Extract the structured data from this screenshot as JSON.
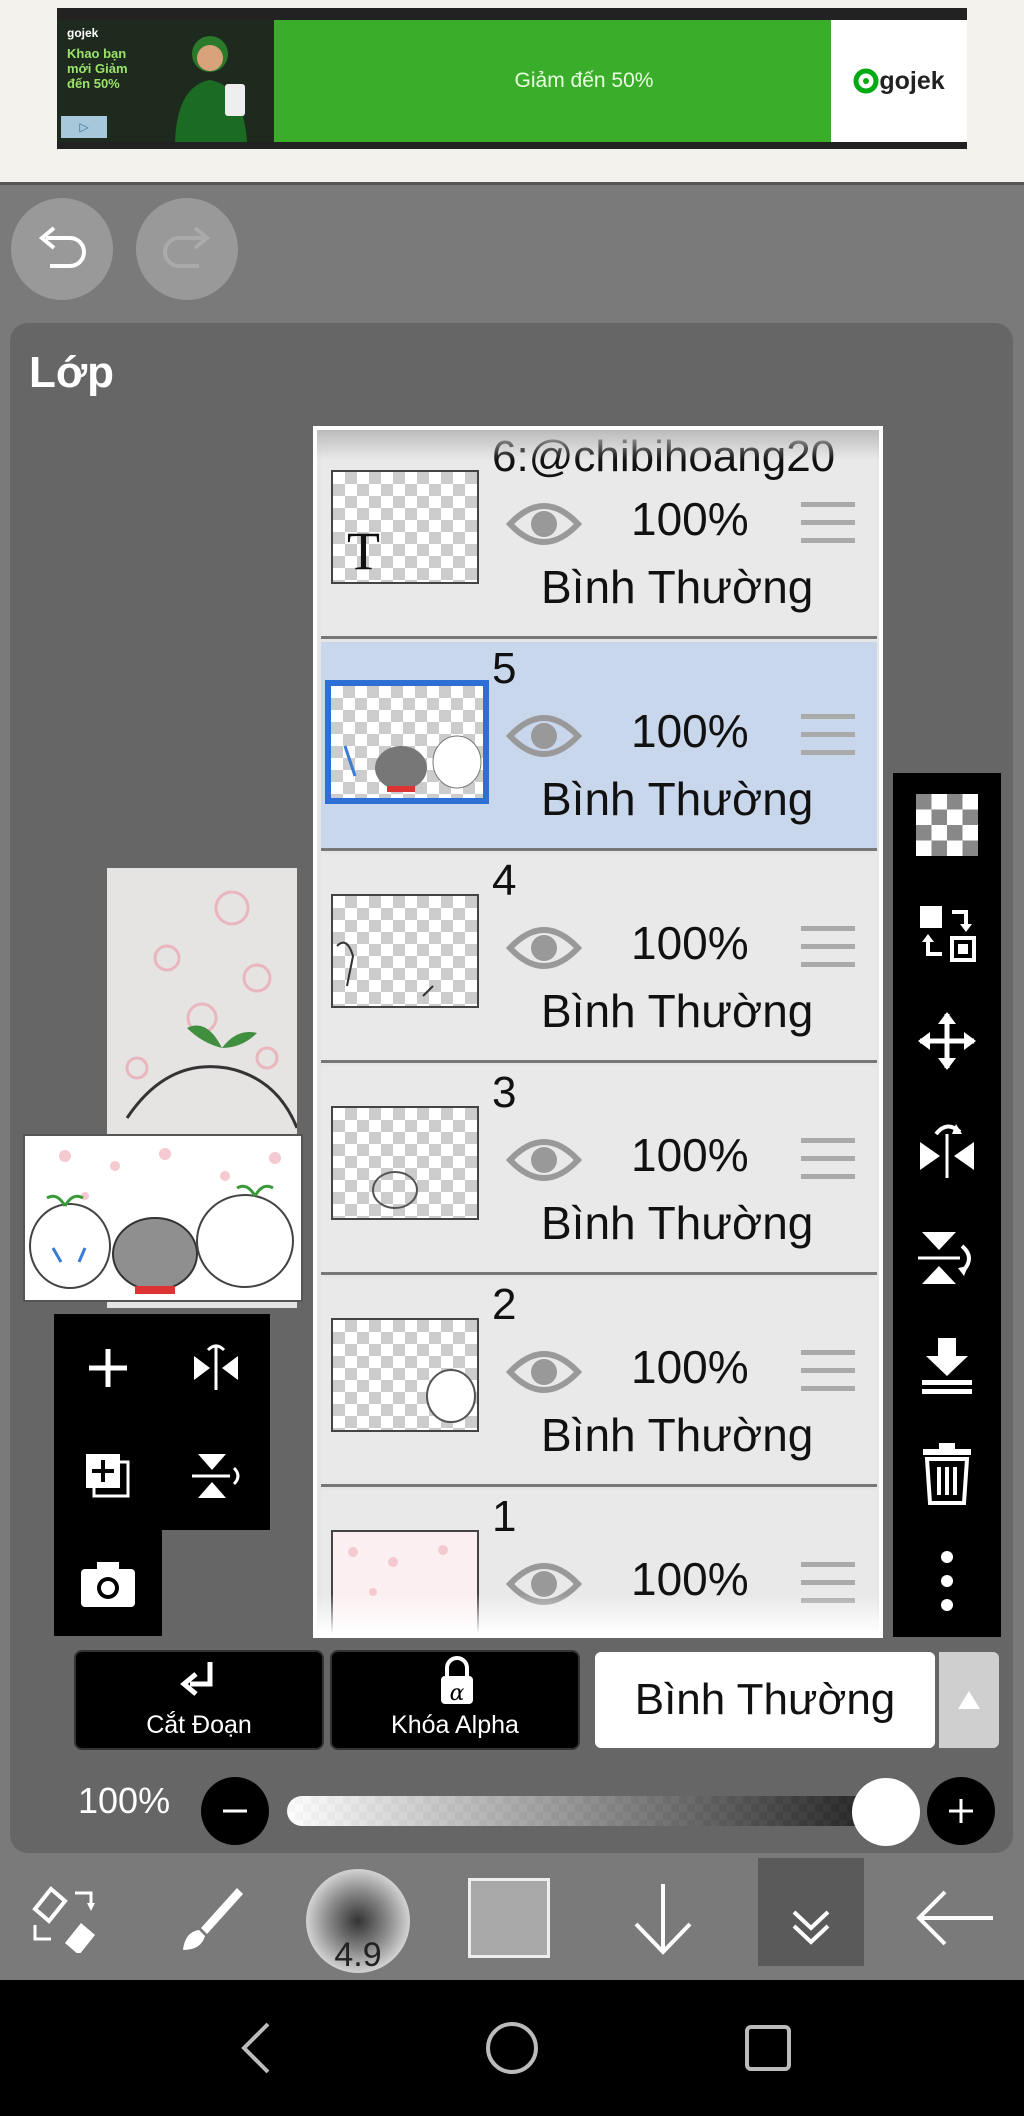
{
  "ad": {
    "brand_small": "gojek",
    "promo_text": "Khao bạn mới Giảm đến 50%",
    "headline": "Giảm đến 50%",
    "brand_logo": "gojek",
    "icons": [
      "ad-choices-icon"
    ]
  },
  "panel": {
    "title": "Lớp"
  },
  "layers": [
    {
      "name": "6:@chibihoang20",
      "opacity": "100%",
      "blend": "Bình Thường",
      "type_glyph": "T",
      "selected": false
    },
    {
      "name": "5",
      "opacity": "100%",
      "blend": "Bình Thường",
      "selected": true
    },
    {
      "name": "4",
      "opacity": "100%",
      "blend": "Bình Thường",
      "selected": false
    },
    {
      "name": "3",
      "opacity": "100%",
      "blend": "Bình Thường",
      "selected": false
    },
    {
      "name": "2",
      "opacity": "100%",
      "blend": "Bình Thường",
      "selected": false
    },
    {
      "name": "1",
      "opacity": "100%",
      "blend": "",
      "selected": false
    }
  ],
  "right_toolbar": [
    "transparency-checker-icon",
    "layer-transfer-icon",
    "move-icon",
    "flip-horizontal-icon",
    "flip-vertical-icon",
    "merge-down-icon",
    "trash-icon",
    "more-vertical-icon"
  ],
  "left_toolbar": [
    "add-layer-icon",
    "flip-layer-icon",
    "duplicate-layer-icon",
    "flip-vertical-icon",
    "camera-icon"
  ],
  "controls": {
    "clip_label": "Cắt Đoạn",
    "alpha_lock_label": "Khóa Alpha",
    "alpha_glyph": "α",
    "blend_mode": "Bình Thường",
    "opacity_label": "100%",
    "opacity_value": 1.0
  },
  "bottom_bar": {
    "brush_size": "4.9",
    "color": "#a8a8a8"
  },
  "colors": {
    "selection_blue": "#2d6fd4",
    "selected_row": "#c9d7ec",
    "ad_green": "#3aae2a"
  }
}
